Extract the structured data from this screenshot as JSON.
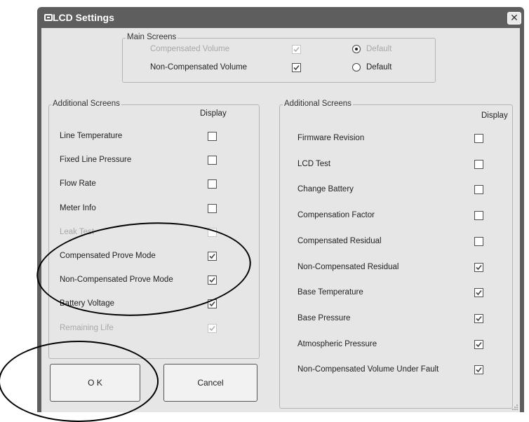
{
  "window": {
    "title": "LCD Settings",
    "close_glyph": "✕"
  },
  "main_screens": {
    "legend": "Main Screens",
    "rows": [
      {
        "label": "Compensated Volume",
        "checked": true,
        "disabled": true,
        "radio_label": "Default",
        "radio_selected": true
      },
      {
        "label": "Non-Compensated Volume",
        "checked": true,
        "disabled": false,
        "radio_label": "Default",
        "radio_selected": false
      }
    ]
  },
  "left_panel": {
    "legend": "Additional Screens",
    "display_header": "Display",
    "items": [
      {
        "label": "Line Temperature",
        "checked": false,
        "disabled": false
      },
      {
        "label": "Fixed Line Pressure",
        "checked": false,
        "disabled": false
      },
      {
        "label": "Flow Rate",
        "checked": false,
        "disabled": false
      },
      {
        "label": "Meter Info",
        "checked": false,
        "disabled": false
      },
      {
        "label": "Leak Test",
        "checked": false,
        "disabled": true
      },
      {
        "label": "Compensated Prove Mode",
        "checked": true,
        "disabled": false
      },
      {
        "label": "Non-Compensated Prove Mode",
        "checked": true,
        "disabled": false
      },
      {
        "label": "Battery Voltage",
        "checked": true,
        "disabled": false
      },
      {
        "label": "Remaining Life",
        "checked": true,
        "disabled": true
      }
    ]
  },
  "right_panel": {
    "legend": "Additional Screens",
    "display_header": "Display",
    "items": [
      {
        "label": "Firmware Revision",
        "checked": false,
        "disabled": false
      },
      {
        "label": "LCD Test",
        "checked": false,
        "disabled": false
      },
      {
        "label": "Change Battery",
        "checked": false,
        "disabled": false
      },
      {
        "label": "Compensation Factor",
        "checked": false,
        "disabled": false
      },
      {
        "label": "Compensated Residual",
        "checked": false,
        "disabled": false
      },
      {
        "label": "Non-Compensated Residual",
        "checked": true,
        "disabled": false
      },
      {
        "label": "Base Temperature",
        "checked": true,
        "disabled": false
      },
      {
        "label": "Base Pressure",
        "checked": true,
        "disabled": false
      },
      {
        "label": "Atmospheric Pressure",
        "checked": true,
        "disabled": false
      },
      {
        "label": "Non-Compensated Volume Under Fault",
        "checked": true,
        "disabled": false
      }
    ]
  },
  "buttons": {
    "ok_label": "O K",
    "cancel_label": "Cancel"
  },
  "icons": {
    "title": "app-icon",
    "close": "close-icon",
    "check": "check-icon",
    "grip": "resize-grip-icon"
  }
}
